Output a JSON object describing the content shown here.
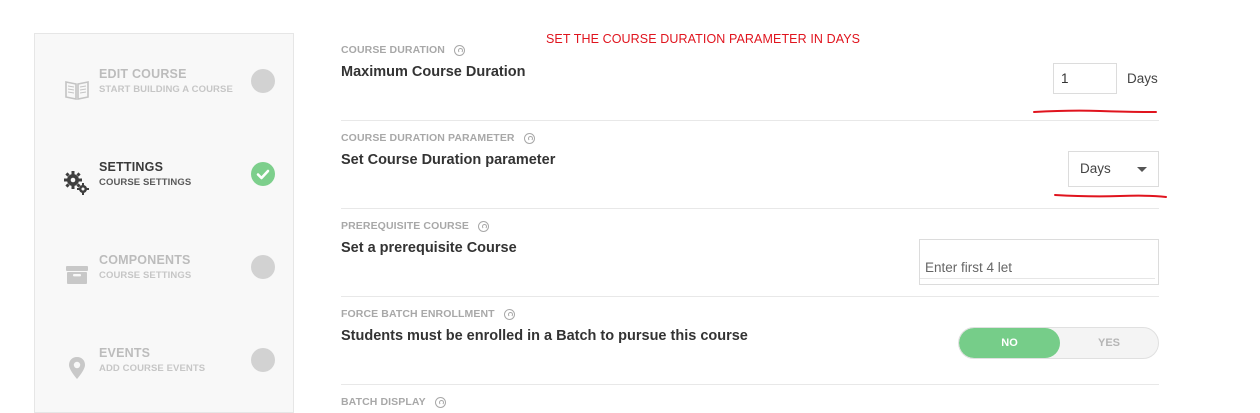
{
  "annotation": "SET THE COURSE DURATION PARAMETER IN DAYS",
  "sidebar": {
    "steps": [
      {
        "title": "EDIT COURSE",
        "subtitle": "START BUILDING A COURSE",
        "icon": "book-icon",
        "status": "pending"
      },
      {
        "title": "SETTINGS",
        "subtitle": "COURSE SETTINGS",
        "icon": "gears-icon",
        "status": "complete"
      },
      {
        "title": "COMPONENTS",
        "subtitle": "COURSE SETTINGS",
        "icon": "archive-icon",
        "status": "pending"
      },
      {
        "title": "EVENTS",
        "subtitle": "ADD COURSE EVENTS",
        "icon": "map-marker-icon",
        "status": "pending"
      }
    ]
  },
  "settings": {
    "duration": {
      "label": "COURSE DURATION",
      "title": "Maximum Course Duration",
      "value": "1",
      "unit": "Days"
    },
    "duration_param": {
      "label": "COURSE DURATION PARAMETER",
      "title": "Set Course Duration parameter",
      "selected": "Days"
    },
    "prerequisite": {
      "label": "PREREQUISITE COURSE",
      "title": "Set a prerequisite Course",
      "placeholder": "Enter first 4 let"
    },
    "force_batch": {
      "label": "FORCE BATCH ENROLLMENT",
      "title": "Students must be enrolled in a Batch to pursue this course",
      "no_label": "NO",
      "yes_label": "YES",
      "selected": "NO"
    },
    "batch_display": {
      "label": "BATCH DISPLAY"
    }
  },
  "colors": {
    "accent_green": "#76cd89",
    "annotation_red": "#e0141e"
  }
}
